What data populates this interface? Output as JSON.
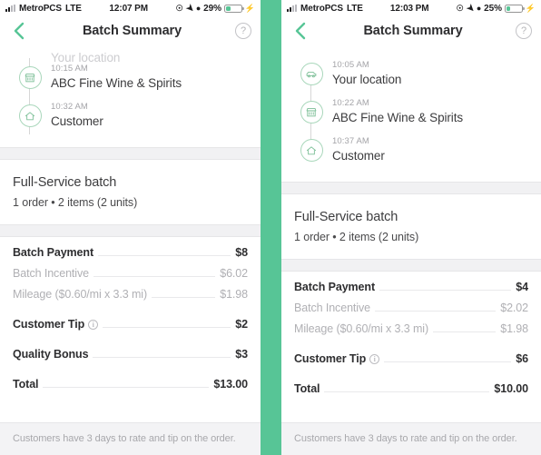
{
  "left": {
    "status_bar": {
      "carrier": "MetroPCS",
      "network": "LTE",
      "time": "12:07 PM",
      "battery_percent": "29%",
      "battery_level": 29,
      "icons": [
        "rotation-lock-icon",
        "location-arrow-icon",
        "do-not-disturb-icon",
        "battery-icon",
        "charging-bolt-icon"
      ]
    },
    "nav": {
      "back_label": "back-chevron",
      "title": "Batch Summary",
      "help_label": "?"
    },
    "timeline": [
      {
        "time": "",
        "name": "Your location",
        "icon": "car-icon",
        "clipped": true
      },
      {
        "time": "10:15 AM",
        "name": "ABC Fine Wine & Spirits",
        "icon": "store-icon",
        "clipped": false
      },
      {
        "time": "10:32 AM",
        "name": "Customer",
        "icon": "home-icon",
        "clipped": false
      }
    ],
    "batch": {
      "title": "Full-Service batch",
      "subtitle": "1 order • 2 items (2 units)"
    },
    "payments": [
      {
        "label": "Batch Payment",
        "value": "$8",
        "muted": false,
        "info": false,
        "gap": false
      },
      {
        "label": "Batch Incentive",
        "value": "$6.02",
        "muted": true,
        "info": false,
        "gap": false
      },
      {
        "label": "Mileage ($0.60/mi x 3.3 mi)",
        "value": "$1.98",
        "muted": true,
        "info": false,
        "gap": false
      },
      {
        "label": "Customer Tip",
        "value": "$2",
        "muted": false,
        "info": true,
        "gap": true
      },
      {
        "label": "Quality Bonus",
        "value": "$3",
        "muted": false,
        "info": false,
        "gap": true
      },
      {
        "label": "Total",
        "value": "$13.00",
        "muted": false,
        "info": false,
        "gap": true
      }
    ],
    "footer": "Customers have 3 days to rate and tip on the order."
  },
  "right": {
    "status_bar": {
      "carrier": "MetroPCS",
      "network": "LTE",
      "time": "12:03 PM",
      "battery_percent": "25%",
      "battery_level": 25,
      "icons": [
        "rotation-lock-icon",
        "location-arrow-icon",
        "do-not-disturb-icon",
        "battery-icon",
        "charging-bolt-icon"
      ]
    },
    "nav": {
      "back_label": "back-chevron",
      "title": "Batch Summary",
      "help_label": "?"
    },
    "timeline": [
      {
        "time": "10:05 AM",
        "name": "Your location",
        "icon": "car-icon",
        "clipped": false
      },
      {
        "time": "10:22 AM",
        "name": "ABC Fine Wine & Spirits",
        "icon": "store-icon",
        "clipped": false
      },
      {
        "time": "10:37 AM",
        "name": "Customer",
        "icon": "home-icon",
        "clipped": false
      }
    ],
    "batch": {
      "title": "Full-Service batch",
      "subtitle": "1 order • 2 items (2 units)"
    },
    "payments": [
      {
        "label": "Batch Payment",
        "value": "$4",
        "muted": false,
        "info": false,
        "gap": false
      },
      {
        "label": "Batch Incentive",
        "value": "$2.02",
        "muted": true,
        "info": false,
        "gap": false
      },
      {
        "label": "Mileage ($0.60/mi x 3.3 mi)",
        "value": "$1.98",
        "muted": true,
        "info": false,
        "gap": false
      },
      {
        "label": "Customer Tip",
        "value": "$6",
        "muted": false,
        "info": true,
        "gap": true
      },
      {
        "label": "Total",
        "value": "$10.00",
        "muted": false,
        "info": false,
        "gap": true
      }
    ],
    "footer": "Customers have 3 days to rate and tip on the order."
  },
  "theme": {
    "accent_green": "#57c596",
    "icon_ring_green": "#a9d7bb",
    "text_dark": "#2e2e30",
    "text_muted": "#b0b0b4",
    "band_gray": "#f1f1f3"
  }
}
